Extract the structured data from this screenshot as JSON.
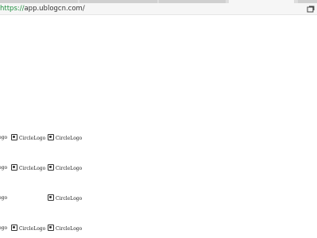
{
  "browser": {
    "tabs": [
      {
        "title": "",
        "active": false
      },
      {
        "title": "",
        "active": false
      },
      {
        "title": "",
        "active": false
      },
      {
        "title": "",
        "active": true
      }
    ],
    "url_scheme": "https://",
    "url_rest": "app.ublogcn.com/"
  },
  "logos": {
    "partial_text": "ogo",
    "label": "CircleLogo",
    "icon": "circle-logo-icon"
  },
  "rows": [
    {
      "partial": "ogo",
      "cells": [
        "CircleLogo",
        "CircleLogo"
      ]
    },
    {
      "partial": "ogo",
      "cells": [
        "CircleLogo",
        "CircleLogo"
      ]
    },
    {
      "partial": "ogo",
      "cells": [
        "",
        "CircleLogo"
      ]
    },
    {
      "partial": "ogo",
      "cells": [
        "CircleLogo",
        "CircleLogo"
      ]
    }
  ]
}
